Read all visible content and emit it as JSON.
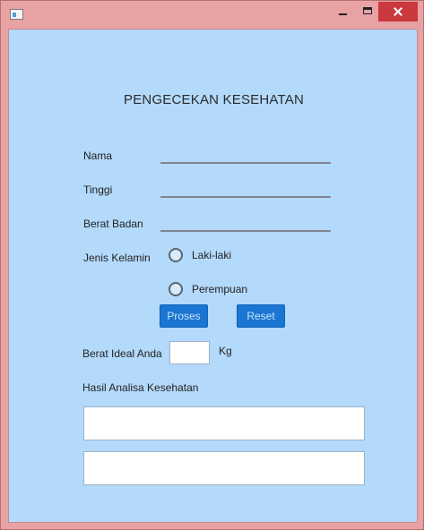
{
  "window": {
    "title": ""
  },
  "form": {
    "heading": "PENGECEKAN KESEHATAN",
    "nama_label": "Nama",
    "nama_value": "",
    "tinggi_label": "Tinggi",
    "tinggi_value": "",
    "berat_label": "Berat Badan",
    "berat_value": "",
    "gender_label": "Jenis Kelamin",
    "gender_options": [
      "Laki-laki",
      "Perempuan"
    ],
    "proses_label": "Proses",
    "reset_label": "Reset",
    "ideal_label": "Berat Ideal Anda",
    "ideal_value": "",
    "ideal_unit": "Kg",
    "hasil_label": "Hasil Analisa Kesehatan",
    "hasil_value_1": "",
    "hasil_value_2": ""
  },
  "colors": {
    "titlebar": "#e8a2a4",
    "client_bg": "#b3d9fb",
    "button_bg": "#1a76d2",
    "close_button": "#c9393d"
  }
}
